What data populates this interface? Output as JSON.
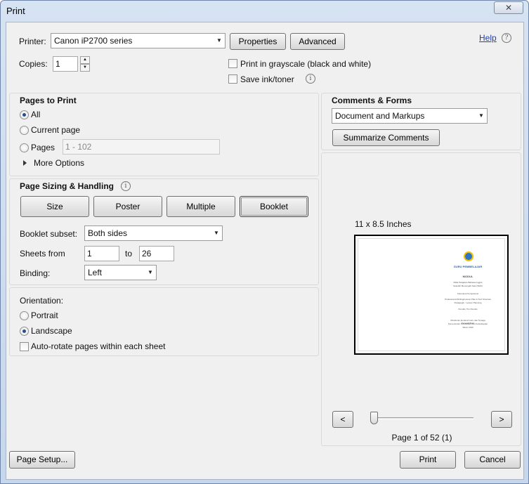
{
  "window": {
    "title": "Print",
    "close_glyph": "✕"
  },
  "printer": {
    "label": "Printer:",
    "selected": "Canon iP2700 series",
    "properties_label": "Properties",
    "advanced_label": "Advanced",
    "help_label": "Help",
    "help_icon": "?"
  },
  "copies": {
    "label": "Copies:",
    "value": "1"
  },
  "options": {
    "grayscale_label": "Print in grayscale (black and white)",
    "save_ink_label": "Save ink/toner",
    "info_icon": "i"
  },
  "pages_to_print": {
    "heading": "Pages to Print",
    "all_label": "All",
    "current_label": "Current page",
    "pages_label": "Pages",
    "pages_placeholder": "1 - 102",
    "more_options_label": "More Options",
    "selected": "All"
  },
  "sizing": {
    "heading": "Page Sizing & Handling",
    "info_icon": "i",
    "buttons": {
      "size": "Size",
      "poster": "Poster",
      "multiple": "Multiple",
      "booklet": "Booklet"
    },
    "active": "Booklet",
    "booklet_subset_label": "Booklet subset:",
    "booklet_subset_value": "Both sides",
    "sheets_from_label": "Sheets from",
    "sheets_from_value": "1",
    "sheets_to_label": "to",
    "sheets_to_value": "26",
    "binding_label": "Binding:",
    "binding_value": "Left"
  },
  "orientation": {
    "heading": "Orientation:",
    "portrait_label": "Portrait",
    "landscape_label": "Landscape",
    "autorotate_label": "Auto-rotate pages within each sheet",
    "selected": "Landscape"
  },
  "comments": {
    "heading": "Comments & Forms",
    "selected": "Document and Markups",
    "summarize_label": "Summarize Comments"
  },
  "preview": {
    "size_label": "11 x 8.5 Inches",
    "page_text": {
      "org": "GURU PEMBELAJAR",
      "title": "MODUL",
      "line1": "Mata Pelajaran Bahasa Inggris",
      "line2": "Sekolah Menengah Atas (SMA)",
      "line3": "Kelompok Kompetensi",
      "line4": "Professional Writing/Lesson Plan & Text Structure",
      "line5": "Pedagogik : Lesson Planning",
      "line6": "Penulis: Tim Penulis",
      "line7": "Direktorat Jenderal Guru dan Tenaga Kependidikan",
      "line8": "Kementerian Pendidikan dan Kebudayaan",
      "line9": "Tahun 2016"
    },
    "prev_label": "<",
    "next_label": ">",
    "page_status": "Page 1 of 52 (1)",
    "slider_position": 0
  },
  "footer": {
    "page_setup_label": "Page Setup...",
    "print_label": "Print",
    "cancel_label": "Cancel"
  }
}
